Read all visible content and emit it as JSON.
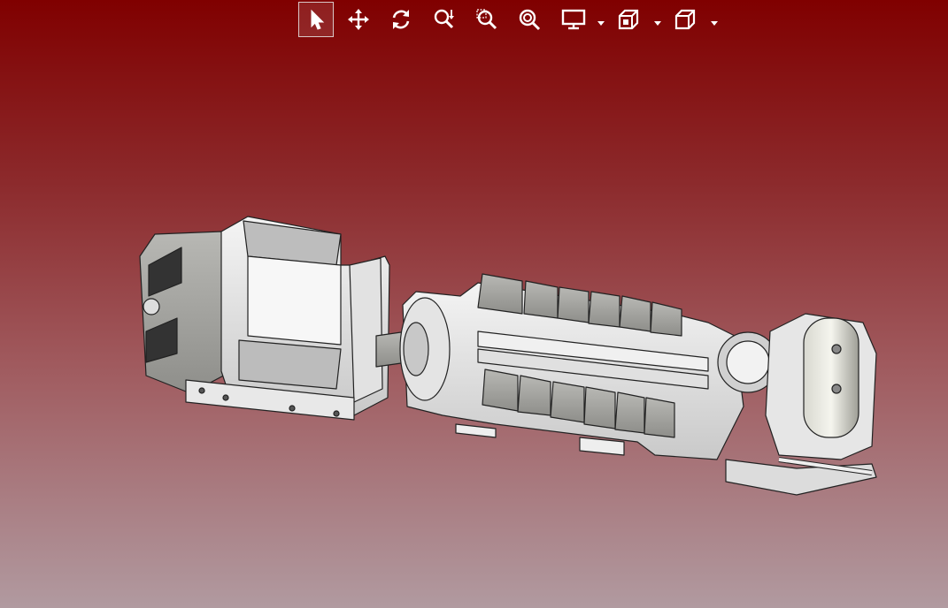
{
  "app": {
    "background_top": "#800000",
    "background_bottom": "#b19aa0"
  },
  "toolbar": {
    "tools": [
      {
        "name": "select",
        "icon": "cursor-arrow-icon",
        "active": true
      },
      {
        "name": "pan",
        "icon": "move-arrows-icon",
        "active": false
      },
      {
        "name": "rotate",
        "icon": "rotate-icon",
        "active": false
      },
      {
        "name": "zoom",
        "icon": "zoom-icon",
        "active": false
      },
      {
        "name": "zoom-window",
        "icon": "zoom-window-icon",
        "active": false
      },
      {
        "name": "zoom-fit",
        "icon": "zoom-fit-icon",
        "active": false
      },
      {
        "name": "display",
        "icon": "monitor-icon",
        "has_menu": true
      },
      {
        "name": "section",
        "icon": "section-box-icon",
        "has_menu": true
      },
      {
        "name": "view-cube",
        "icon": "cube-icon",
        "has_menu": true
      }
    ],
    "icon_color": "#ffffff"
  },
  "model": {
    "description_icon": "generator-engine-assembly-3d-model",
    "part_color": "#ececec",
    "edge_color": "#222222"
  }
}
